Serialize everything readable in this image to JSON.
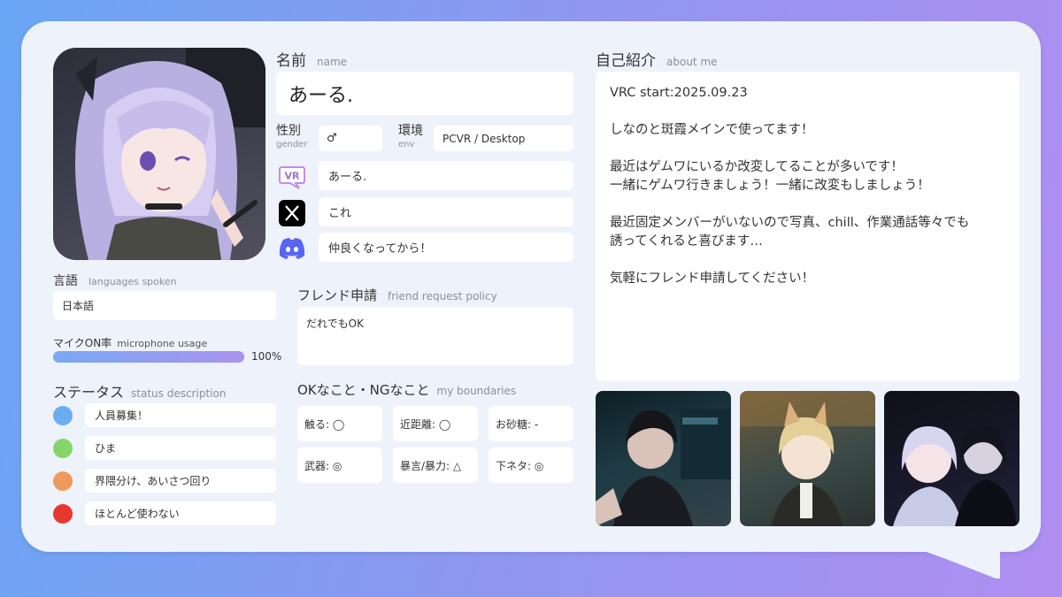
{
  "profile": {
    "name_label": "名前",
    "name_sub": "name",
    "name_value": "あーる.",
    "gender_label": "性別",
    "gender_sub": "gender",
    "gender_value": "♂",
    "env_label": "環境",
    "env_sub": "env",
    "env_value": "PCVR / Desktop",
    "vrchat_value": "あーる.",
    "x_value": "これ",
    "discord_value": "仲良くなってから！"
  },
  "languages": {
    "label": "言語",
    "sub": "languages spoken",
    "value": "日本語"
  },
  "mic": {
    "label": "マイクON率",
    "sub": "microphone usage",
    "percent": 100,
    "percent_text": "100%"
  },
  "status": {
    "label": "ステータス",
    "sub": "status description",
    "items": [
      {
        "color": "#6aaef0",
        "text": "人員募集！"
      },
      {
        "color": "#86d56a",
        "text": "ひま"
      },
      {
        "color": "#f0995c",
        "text": "界隈分け、あいさつ回り"
      },
      {
        "color": "#e8372f",
        "text": "ほとんど使わない"
      }
    ]
  },
  "friend": {
    "label": "フレンド申請",
    "sub": "friend request policy",
    "value": "だれでもOK"
  },
  "boundaries": {
    "label": "OKなこと・NGなこと",
    "sub": "my boundaries",
    "items": [
      "触る: ◯",
      "近距離: ◯",
      "お砂糖: -",
      "武器: ◎",
      "暴言/暴力: △",
      "下ネタ: ◎"
    ]
  },
  "about": {
    "label": "自己紹介",
    "sub": "about me",
    "text": "VRC start:2025.09.23\n\nしなのと斑霞メインで使ってます！\n\n最近はゲムワにいるか改変してることが多いです！\n一緒にゲムワ行きましょう！一緒に改変もしましょう！\n\n最近固定メンバーがいないので写真、chill、作業通話等々でも\n誘ってくれると喜びます…\n\n気軽にフレンド申請してください！"
  },
  "icons": {
    "vrchat": "vrchat-icon",
    "x": "x-icon",
    "discord": "discord-icon"
  },
  "colors": {
    "vrchat": "#c38be8",
    "discord": "#5865f2"
  }
}
